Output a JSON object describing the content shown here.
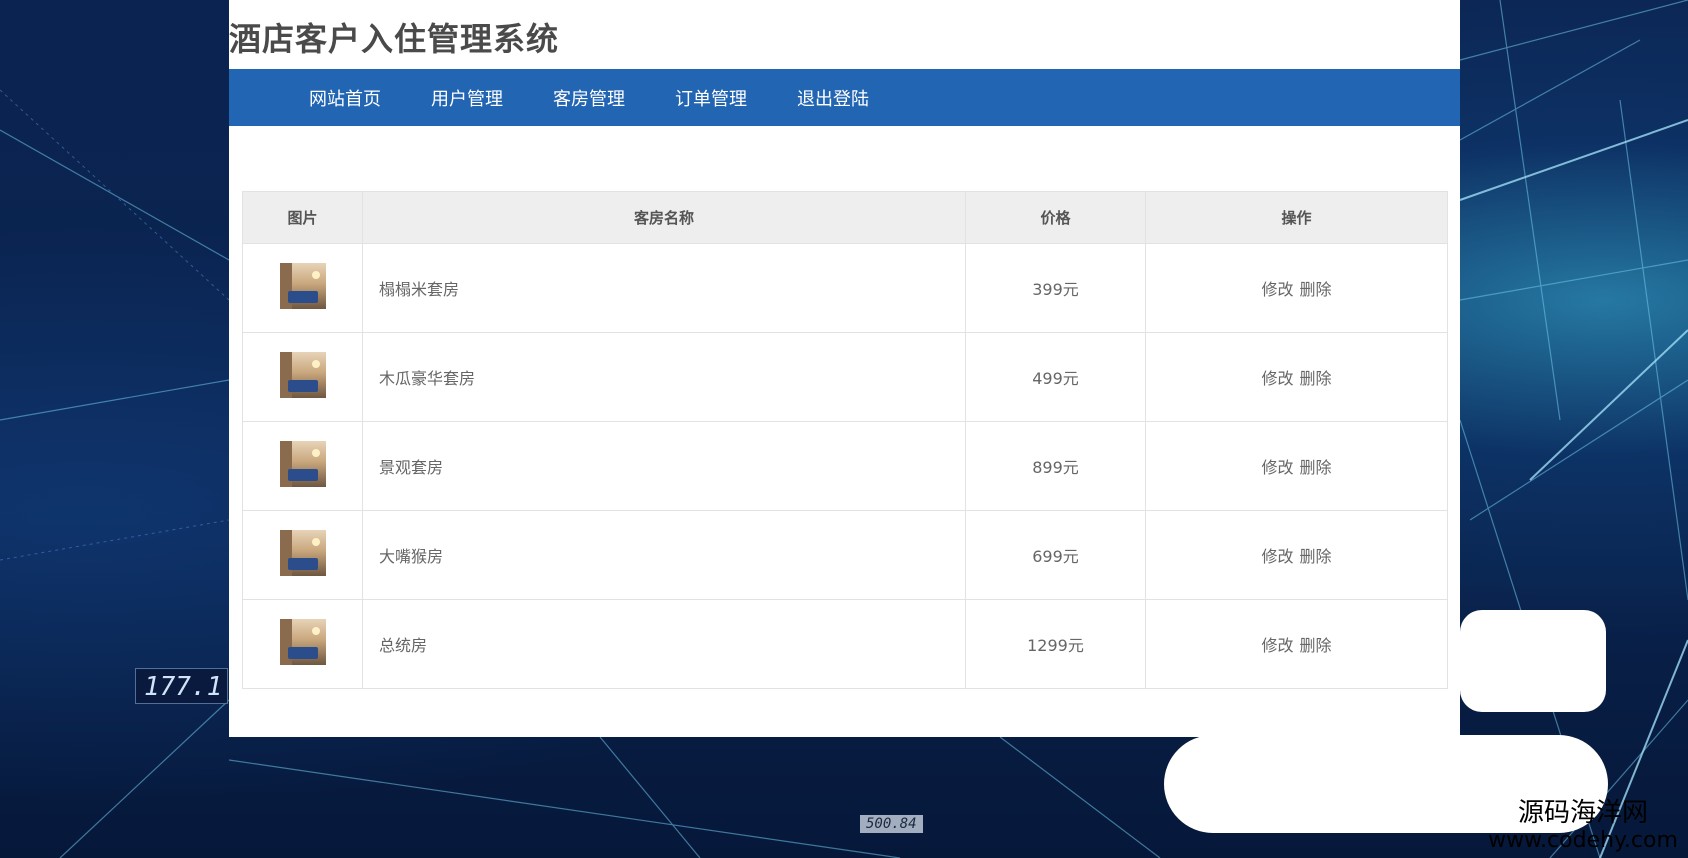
{
  "header": {
    "title": "酒店客户入住管理系统"
  },
  "nav": {
    "items": [
      {
        "label": "网站首页"
      },
      {
        "label": "用户管理"
      },
      {
        "label": "客房管理"
      },
      {
        "label": "订单管理"
      },
      {
        "label": "退出登陆"
      }
    ]
  },
  "table": {
    "headers": {
      "image": "图片",
      "name": "客房名称",
      "price": "价格",
      "actions": "操作"
    },
    "rows": [
      {
        "name": "榻榻米套房",
        "price": "399元",
        "edit": "修改",
        "delete": "删除"
      },
      {
        "name": "木瓜豪华套房",
        "price": "499元",
        "edit": "修改",
        "delete": "删除"
      },
      {
        "name": "景观套房",
        "price": "899元",
        "edit": "修改",
        "delete": "删除"
      },
      {
        "name": "大嘴猴房",
        "price": "699元",
        "edit": "修改",
        "delete": "删除"
      },
      {
        "name": "总统房",
        "price": "1299元",
        "edit": "修改",
        "delete": "删除"
      }
    ]
  },
  "overlay": {
    "hud_left": "177.1",
    "hud_bottom": "500.84"
  },
  "watermark": {
    "name": "源码海洋网",
    "url": "www.codehy.com"
  },
  "colors": {
    "nav_bg": "#2265b2",
    "page_bg": "#0b2350",
    "header_cell_bg": "#eeeeee"
  }
}
